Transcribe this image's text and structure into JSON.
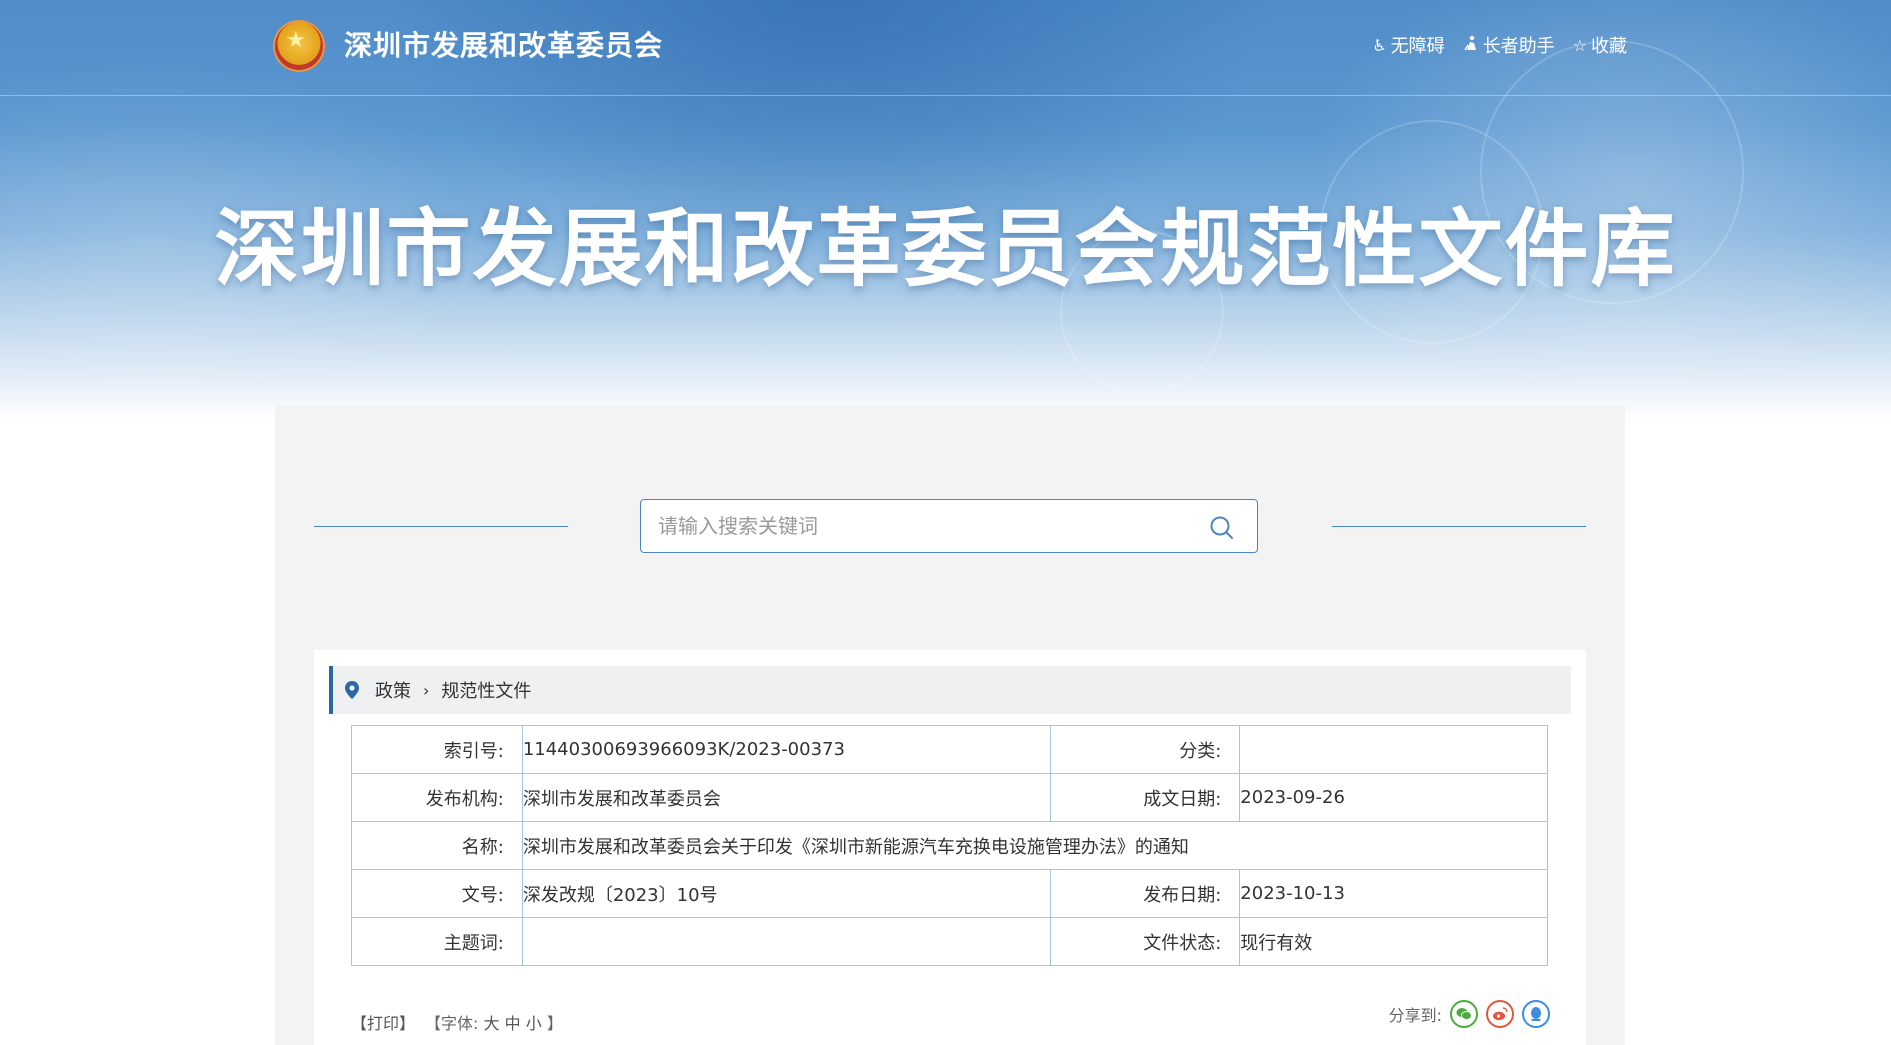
{
  "header": {
    "site_name": "深圳市发展和改革委员会",
    "tools": [
      {
        "label": "无障碍",
        "icon": "accessibility-icon"
      },
      {
        "label": "长者助手",
        "icon": "elder-assist-icon"
      },
      {
        "label": "收藏",
        "icon": "star-icon"
      }
    ],
    "banner_title": "深圳市发展和改革委员会规范性文件库"
  },
  "search": {
    "placeholder": "请输入搜索关键词"
  },
  "breadcrumb": {
    "items": [
      "政策",
      "规范性文件"
    ]
  },
  "meta_table": {
    "index_no_label": "索引号:",
    "index_no_value": "11440300693966093K/2023-00373",
    "category_label": "分类:",
    "category_value": "",
    "publisher_label": "发布机构:",
    "publisher_value": "深圳市发展和改革委员会",
    "written_date_label": "成文日期:",
    "written_date_value": "2023-09-26",
    "name_label": "名称:",
    "name_value": "深圳市发展和改革委员会关于印发《深圳市新能源汽车充换电设施管理办法》的通知",
    "doc_no_label": "文号:",
    "doc_no_value": "深发改规〔2023〕10号",
    "publish_date_label": "发布日期:",
    "publish_date_value": "2023-10-13",
    "keywords_label": "主题词:",
    "keywords_value": "",
    "status_label": "文件状态:",
    "status_value": "现行有效"
  },
  "page_tools": {
    "print": "【打印】",
    "font_prefix": "【字体:",
    "font_large": "大",
    "font_medium": "中",
    "font_small": "小",
    "font_suffix": "】"
  },
  "share": {
    "label": "分享到:"
  },
  "colors": {
    "accent": "#2f66a8",
    "border": "#a9c2de",
    "search_border": "#4c86c0"
  }
}
